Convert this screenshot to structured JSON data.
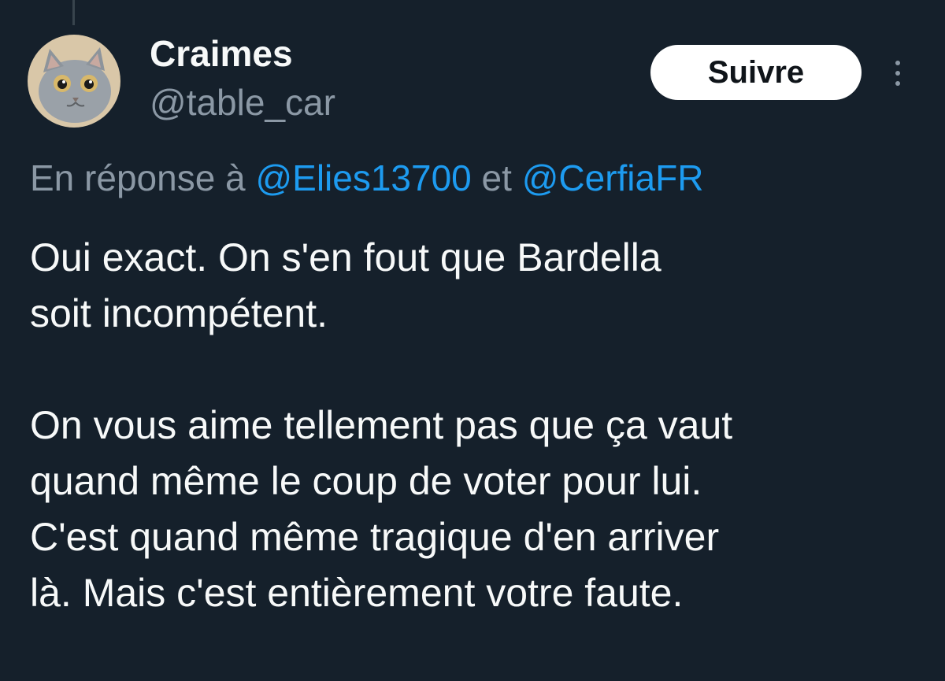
{
  "tweet": {
    "author": {
      "display_name": "Craimes",
      "handle": "@table_car",
      "avatar_icon": "cat-avatar"
    },
    "follow_button_label": "Suivre",
    "more_icon": "more-vertical-icon",
    "reply": {
      "prefix": "En réponse à",
      "mention_1": "@Elies13700",
      "conjunction": "et",
      "mention_2": "@CerfiaFR"
    },
    "paragraphs": [
      "Oui exact. On s'en fout que Bardella\nsoit incompétent.",
      "On vous aime tellement pas que ça vaut\nquand même le coup de voter pour lui.\nC'est quand même tragique d'en arriver\nlà. Mais c'est entièrement votre faute."
    ]
  },
  "colors": {
    "background": "#15202b",
    "text_primary": "#f7f9f9",
    "text_secondary": "#8b98a5",
    "link": "#1d9bf0",
    "button_bg": "#ffffff",
    "button_text": "#0f1419"
  }
}
